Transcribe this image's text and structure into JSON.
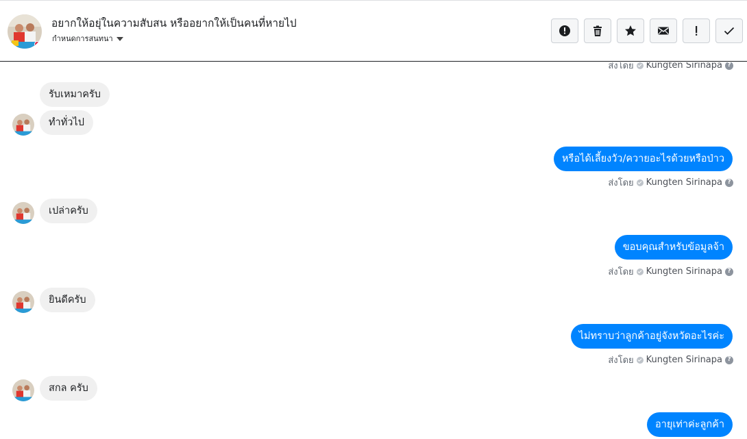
{
  "header": {
    "avatar_icon": "profile-photo",
    "title": "อยากให้อยุ่ในความสับสน หรืออยากให้เป็นคนที่หายไป",
    "subtitle": "กำหนดการสนทนา",
    "actions": [
      {
        "name": "report",
        "icon": "exclamation-circle-icon",
        "label": "Report"
      },
      {
        "name": "delete",
        "icon": "trash-icon",
        "label": "Delete"
      },
      {
        "name": "star",
        "icon": "star-icon",
        "label": "Star"
      },
      {
        "name": "mark-unread",
        "icon": "envelope-icon",
        "label": "Mark as unread"
      },
      {
        "name": "spam",
        "icon": "exclamation-icon",
        "label": "Mark as spam"
      },
      {
        "name": "done",
        "icon": "check-icon",
        "label": "Done"
      }
    ]
  },
  "sender_meta": {
    "prefix": "ส่งโดย",
    "name": "Kungten Sirinapa",
    "help": "?"
  },
  "messages": [
    {
      "direction": "in",
      "text": "รับเหมาครับ"
    },
    {
      "direction": "in",
      "text": "ทำทั่วไป"
    },
    {
      "direction": "out",
      "text": "หรือได้เลี้ยงวัว/ควายอะไรด้วยหรือป่าว"
    },
    {
      "direction": "in",
      "text": "เปล่าครับ"
    },
    {
      "direction": "out",
      "text": "ขอบคุณสำหรับข้อมูลจ้า"
    },
    {
      "direction": "in",
      "text": "ยินดีครับ"
    },
    {
      "direction": "out",
      "text": "ไม่ทราบว่าลูกค้าอยู่จังหวัดอะไรค่ะ"
    },
    {
      "direction": "in",
      "text": "สกล ครับ"
    },
    {
      "direction": "out",
      "text": "อายุเท่าค่ะลูกค้า"
    }
  ],
  "colors": {
    "outgoing_bubble": "#0084ff",
    "incoming_bubble": "#f0f0f0"
  }
}
